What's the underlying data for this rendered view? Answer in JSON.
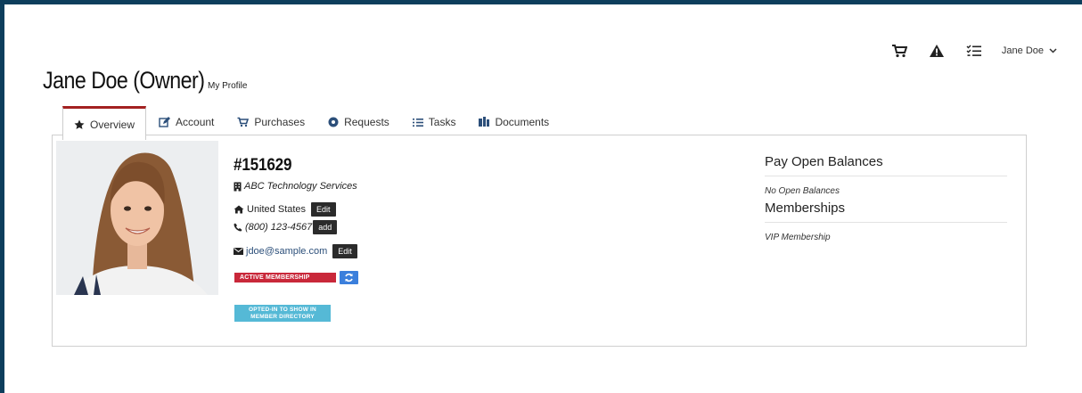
{
  "user_menu": {
    "name": "Jane  Doe"
  },
  "icons": {
    "cart": "cart-icon",
    "alert": "warning-icon",
    "tasks": "tasks-list-icon",
    "caret": "chevron-down-icon"
  },
  "header": {
    "title": "Jane Doe (Owner)",
    "subtitle": "My Profile"
  },
  "tabs": [
    {
      "label": "Overview",
      "icon": "star-icon",
      "active": true
    },
    {
      "label": "Account",
      "icon": "edit-icon"
    },
    {
      "label": "Purchases",
      "icon": "cart-icon"
    },
    {
      "label": "Requests",
      "icon": "gear-circle-icon"
    },
    {
      "label": "Tasks",
      "icon": "tasks-list-icon"
    },
    {
      "label": "Documents",
      "icon": "documents-icon"
    }
  ],
  "profile": {
    "member_id": "#151629",
    "company": "ABC Technology Services",
    "country": "United States",
    "phone": "(800)  123-4567",
    "email": "jdoe@sample.com",
    "edit_label": "Edit",
    "add_label": "add",
    "membership_badge": "ACTIVE MEMBERSHIP",
    "directory_badge_line1": "OPTED-IN TO SHOW IN",
    "directory_badge_line2": "MEMBER DIRECTORY"
  },
  "sidebar": {
    "balances_title": "Pay Open Balances",
    "balances_note": "No Open Balances",
    "memberships_title": "Memberships",
    "membership_item": "VIP Membership"
  },
  "colors": {
    "frame": "#0d3e5c",
    "tab_accent": "#a32121",
    "badge_red": "#c9283a",
    "badge_blue": "#55b9d6",
    "refresh_blue": "#3b7fdc"
  }
}
